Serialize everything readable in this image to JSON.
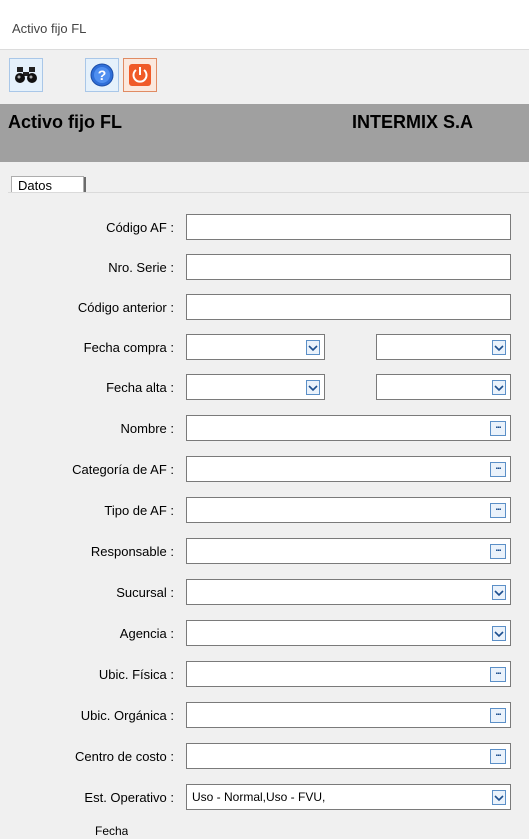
{
  "window": {
    "title": "Activo fijo FL"
  },
  "toolbar": {
    "buttons": [
      {
        "name": "search",
        "icon": "binoculars-icon"
      },
      {
        "name": "help",
        "icon": "help-icon"
      },
      {
        "name": "exit",
        "icon": "power-icon"
      }
    ]
  },
  "header": {
    "form_title": "Activo fijo FL",
    "company": "INTERMIX S.A"
  },
  "tabs": [
    {
      "label": "Datos"
    }
  ],
  "form": {
    "codigo_af": {
      "label": "Código AF :",
      "value": ""
    },
    "nro_serie": {
      "label": "Nro. Serie :",
      "value": ""
    },
    "codigo_anterior": {
      "label": "Código anterior :",
      "value": ""
    },
    "fecha_compra": {
      "label": "Fecha compra :",
      "value1": "",
      "value2": ""
    },
    "fecha_alta": {
      "label": "Fecha alta :",
      "value1": "",
      "value2": ""
    },
    "nombre": {
      "label": "Nombre :",
      "value": ""
    },
    "categoria": {
      "label": "Categoría de AF :",
      "value": ""
    },
    "tipo": {
      "label": "Tipo de AF :",
      "value": ""
    },
    "responsable": {
      "label": "Responsable :",
      "value": ""
    },
    "sucursal": {
      "label": "Sucursal :",
      "value": ""
    },
    "agencia": {
      "label": "Agencia :",
      "value": ""
    },
    "ubic_fisica": {
      "label": "Ubic. Física :",
      "value": ""
    },
    "ubic_organica": {
      "label": "Ubic. Orgánica :",
      "value": ""
    },
    "centro_costo": {
      "label": "Centro de costo :",
      "value": ""
    },
    "est_operativo": {
      "label": "Est. Operativo :",
      "value": "Uso - Normal,Uso - FVU,"
    },
    "next_label_partial": "Fecha"
  },
  "colors": {
    "header_bg": "#a0a0a0",
    "button_border": "#5b8fc7",
    "help_blue": "#2f6fd8",
    "power_orange": "#f05a28"
  }
}
